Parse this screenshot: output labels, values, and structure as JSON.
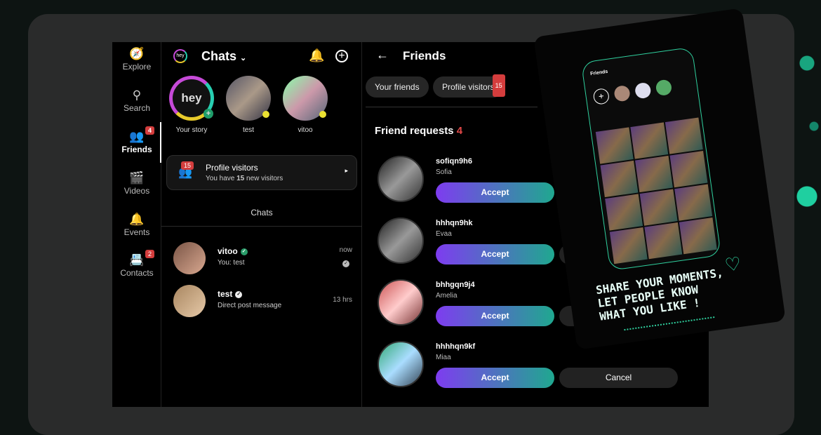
{
  "sidebar": {
    "items": [
      {
        "label": "Explore",
        "icon": "compass-icon",
        "badge": ""
      },
      {
        "label": "Search",
        "icon": "search-icon",
        "badge": ""
      },
      {
        "label": "Friends",
        "icon": "friends-icon",
        "badge": "4"
      },
      {
        "label": "Videos",
        "icon": "clapperboard-icon",
        "badge": ""
      },
      {
        "label": "Events",
        "icon": "bell-icon",
        "badge": ""
      },
      {
        "label": "Contacts",
        "icon": "contacts-icon",
        "badge": "2"
      }
    ]
  },
  "chats": {
    "logo": "hey",
    "title": "Chats",
    "stories": [
      {
        "label": "Your story",
        "logo": "hey"
      },
      {
        "label": "test"
      },
      {
        "label": "vitoo"
      }
    ],
    "profile_visitors": {
      "badge": "15",
      "title": "Profile visitors",
      "subtitle_pre": "You have ",
      "count": "15",
      "subtitle_post": " new visitors"
    },
    "section_label": "Chats",
    "list": [
      {
        "name": "vitoo",
        "message": "You: test",
        "time": "now"
      },
      {
        "name": "test",
        "message": "Direct post message",
        "time": "13 hrs"
      }
    ]
  },
  "friends": {
    "title": "Friends",
    "tabs": [
      {
        "label": "Your friends"
      },
      {
        "label": "Profile visitors",
        "badge": "15"
      }
    ],
    "requests_label": "Friend requests",
    "requests_count": "4",
    "accept_label": "Accept",
    "cancel_label": "Cancel",
    "requests": [
      {
        "username": "sofiqn9h6",
        "name": "Sofia"
      },
      {
        "username": "hhhqn9hk",
        "name": "Evaa"
      },
      {
        "username": "bhhgqn9j4",
        "name": "Amelia"
      },
      {
        "username": "hhhhqn9kf",
        "name": "Miaa"
      }
    ]
  },
  "poster": {
    "phone_title": "Friends",
    "slogan": "SHARE YOUR MOMENTS,\nLET PEOPLE KNOW\nWHAT YOU LIKE !"
  },
  "colors": {
    "accent_gradient_start": "#7e3cf0",
    "accent_gradient_end": "#1fa88f",
    "badge": "#d43d3d",
    "neon": "#2fd09e"
  }
}
